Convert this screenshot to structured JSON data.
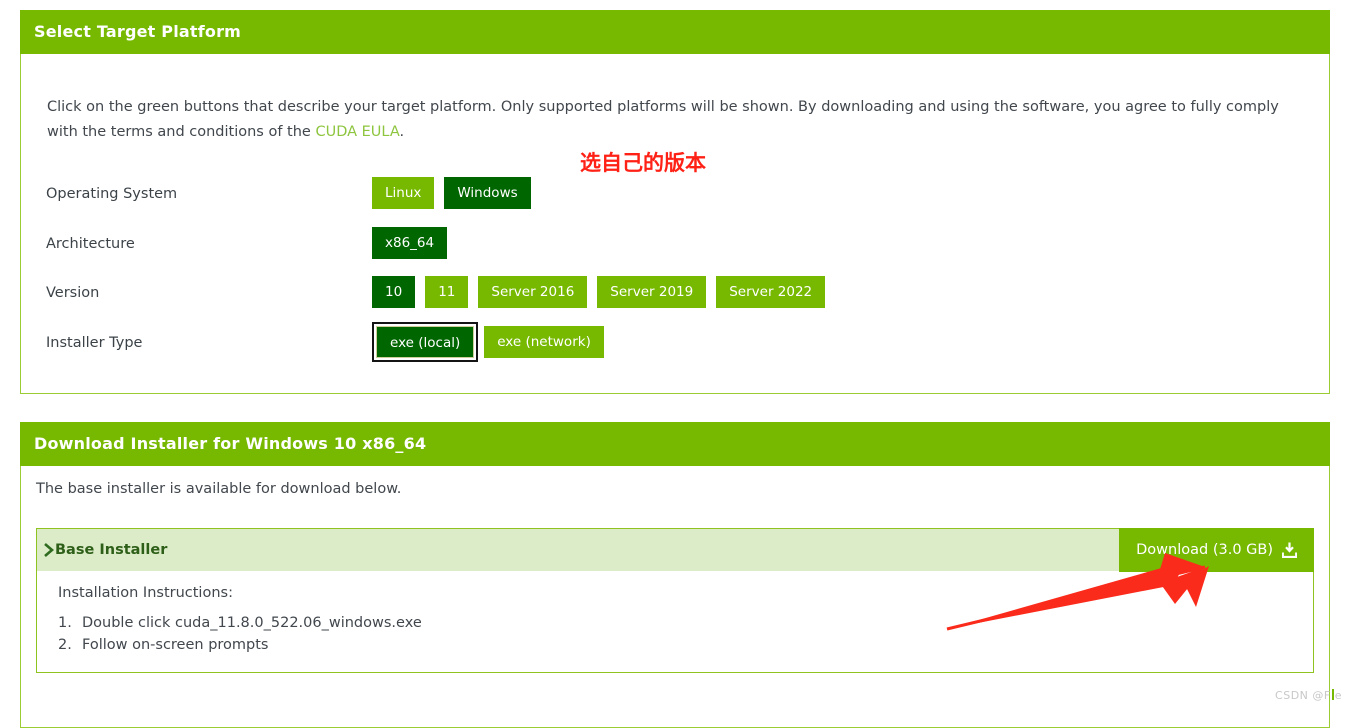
{
  "select_panel": {
    "title": "Select Target Platform",
    "intro_before_link": "Click on the green buttons that describe your target platform. Only supported platforms will be shown. By downloading and using the software, you agree to fully comply with the terms and conditions of the ",
    "intro_link": "CUDA EULA",
    "intro_after_link": ".",
    "annotation": "选自己的版本",
    "rows": [
      {
        "label": "Operating System",
        "options": [
          {
            "label": "Linux",
            "selected": false,
            "focused": false
          },
          {
            "label": "Windows",
            "selected": true,
            "focused": false
          }
        ]
      },
      {
        "label": "Architecture",
        "options": [
          {
            "label": "x86_64",
            "selected": true,
            "focused": false
          }
        ]
      },
      {
        "label": "Version",
        "options": [
          {
            "label": "10",
            "selected": true,
            "focused": false
          },
          {
            "label": "11",
            "selected": false,
            "focused": false
          },
          {
            "label": "Server 2016",
            "selected": false,
            "focused": false
          },
          {
            "label": "Server 2019",
            "selected": false,
            "focused": false
          },
          {
            "label": "Server 2022",
            "selected": false,
            "focused": false
          }
        ]
      },
      {
        "label": "Installer Type",
        "options": [
          {
            "label": "exe (local)",
            "selected": true,
            "focused": true
          },
          {
            "label": "exe (network)",
            "selected": false,
            "focused": false
          }
        ]
      }
    ]
  },
  "download_panel": {
    "title": "Download Installer for Windows 10 x86_64",
    "note": "The base installer is available for download below.",
    "installer": {
      "name": "Base Installer",
      "expand_icon": "chevron-right-icon",
      "download_label": "Download (3.0 GB)",
      "download_icon": "download-icon",
      "instructions_title": "Installation Instructions:",
      "instructions": [
        {
          "num": "1.",
          "text": "Double click cuda_11.8.0_522.06_windows.exe"
        },
        {
          "num": "2.",
          "text": "Follow on-screen prompts"
        }
      ]
    }
  },
  "watermark": {
    "prefix": "CSDN @F",
    "suffix": "e"
  },
  "colors": {
    "nvidia_green": "#76b900",
    "dark_green": "#006600",
    "light_green_row": "#dcecc8",
    "annotation_red": "#ff2116",
    "arrow_red": "#fb2b1c",
    "link_green": "#8ec53f"
  }
}
